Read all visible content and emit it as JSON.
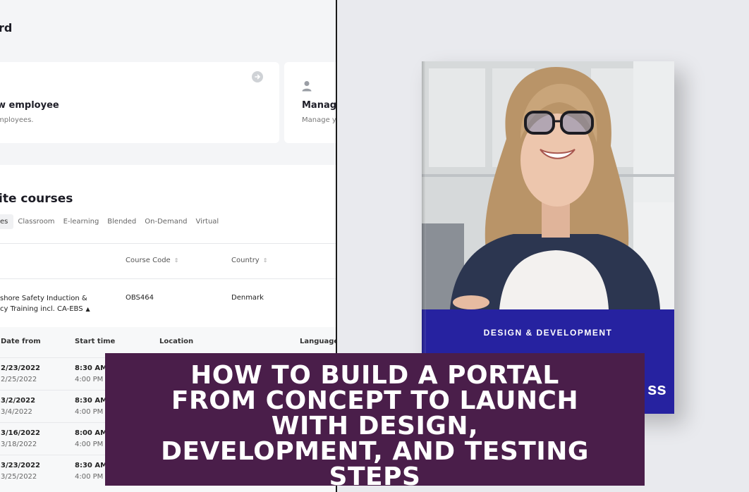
{
  "dashboard": {
    "title": "rd",
    "cards": [
      {
        "title": "w employee",
        "desc": "mployees."
      },
      {
        "title": "Manage",
        "desc": "Manage yo"
      }
    ]
  },
  "courses": {
    "heading": "ite courses",
    "tabs": [
      "es",
      "Classroom",
      "E-learning",
      "Blended",
      "On-Demand",
      "Virtual"
    ],
    "columns": {
      "code": "Course Code",
      "country": "Country"
    },
    "row": {
      "name_line1": "shore Safety Induction &",
      "name_line2": "cy Training incl. CA-EBS",
      "code": "OBS464",
      "country": "Denmark"
    },
    "session_headers": {
      "date": "Date from",
      "start": "Start time",
      "location": "Location",
      "language": "Language"
    },
    "sessions": [
      {
        "date_from": "2/23/2022",
        "date_to": "2/25/2022",
        "start": "8:30 AM",
        "end": "4:00 PM"
      },
      {
        "date_from": "3/2/2022",
        "date_to": "3/4/2022",
        "start": "8:30 AM",
        "end": "4:00 PM"
      },
      {
        "date_from": "3/16/2022",
        "date_to": "3/18/2022",
        "start": "8:00 AM",
        "end": "4:00 PM"
      },
      {
        "date_from": "3/23/2022",
        "date_to": "3/25/2022",
        "start": "8:30 AM",
        "end": "4:00 PM"
      }
    ]
  },
  "book": {
    "kicker": "DESIGN & DEVELOPMENT",
    "partial_title": "ss"
  },
  "overlay": {
    "title": "HOW TO BUILD A PORTAL\nFROM CONCEPT TO LAUNCH\nWITH DESIGN,\nDEVELOPMENT, AND TESTING\nSTEPS"
  },
  "colors": {
    "overlay_bg": "#4a1e4a",
    "book_blue": "#2622a0"
  }
}
